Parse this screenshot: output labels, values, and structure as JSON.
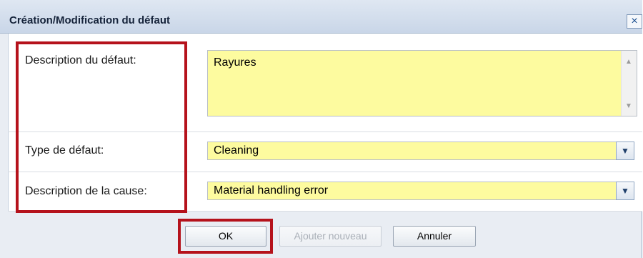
{
  "dialog": {
    "title": "Création/Modification du défaut",
    "close_icon": "×"
  },
  "form": {
    "defect_description": {
      "label": "Description du défaut:",
      "value": "Rayures"
    },
    "defect_type": {
      "label": "Type de défaut:",
      "value": "Cleaning"
    },
    "cause_description": {
      "label": "Description de la cause:",
      "value": "Material handling error"
    }
  },
  "buttons": {
    "ok": "OK",
    "add_new": "Ajouter nouveau",
    "cancel": "Annuler"
  },
  "icons": {
    "scroll_up": "▲",
    "scroll_down": "▼",
    "dropdown": "▼"
  },
  "colors": {
    "field_background": "#fdfb9f",
    "highlight": "#b5121b"
  }
}
